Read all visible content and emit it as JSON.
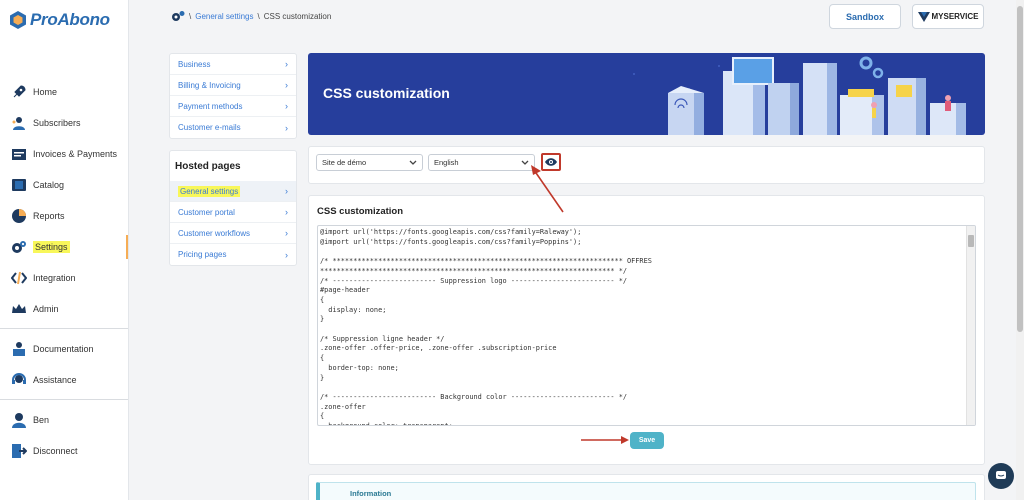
{
  "brand": {
    "name": "ProAbono"
  },
  "sidebar": {
    "items": [
      {
        "label": "Home",
        "icon": "rocket-icon"
      },
      {
        "label": "Subscribers",
        "icon": "subscribers-icon"
      },
      {
        "label": "Invoices & Payments",
        "icon": "invoice-icon"
      },
      {
        "label": "Catalog",
        "icon": "catalog-icon"
      },
      {
        "label": "Reports",
        "icon": "pie-chart-icon"
      },
      {
        "label": "Settings",
        "icon": "gear-icon",
        "active": true
      },
      {
        "label": "Integration",
        "icon": "code-icon"
      },
      {
        "label": "Admin",
        "icon": "crown-icon"
      }
    ],
    "help_items": [
      {
        "label": "Documentation",
        "icon": "book-icon"
      },
      {
        "label": "Assistance",
        "icon": "headset-icon"
      }
    ],
    "user_items": [
      {
        "label": "Ben",
        "icon": "user-icon"
      },
      {
        "label": "Disconnect",
        "icon": "exit-icon"
      }
    ]
  },
  "breadcrumb": {
    "separator": "\\",
    "parent": "General settings",
    "current": "CSS customization"
  },
  "header": {
    "sandbox_label": "Sandbox",
    "service_label": "MYSERVICE"
  },
  "settings_menu": {
    "items": [
      "Business",
      "Billing & Invoicing",
      "Payment methods",
      "Customer e-mails"
    ]
  },
  "hosted_menu": {
    "title": "Hosted pages",
    "items": [
      "General settings",
      "Customer portal",
      "Customer workflows",
      "Pricing pages"
    ]
  },
  "banner": {
    "title": "CSS customization"
  },
  "controls": {
    "site_value": "Site de démo",
    "language_value": "English"
  },
  "css_section": {
    "title": "CSS customization",
    "code_lines": [
      "@import url('https://fonts.googleapis.com/css?family=Raleway');",
      "@import url('https://fonts.googleapis.com/css?family=Poppins');",
      "",
      "/* ********************************************************************** OFFRES",
      "*********************************************************************** */",
      "/* ------------------------- Suppression logo ------------------------- */",
      "#page-header",
      "{",
      "  display: none;",
      "}",
      "",
      "/* Suppression ligne header */",
      ".zone-offer .offer-price, .zone-offer .subscription-price",
      "{",
      "  border-top: none;",
      "}",
      "",
      "/* ------------------------- Background color ------------------------- */",
      ".zone-offer",
      "{",
      "  background-color: transparent;"
    ],
    "save_label": "Save"
  },
  "info": {
    "title": "Information"
  },
  "colors": {
    "brand_blue": "#2b6cb0",
    "banner_navy": "#263e9c",
    "link_blue": "#3a7bd5",
    "save_teal": "#4fb3c8",
    "highlight_yellow": "#f8f75a",
    "annotation_red": "#c0392b"
  }
}
